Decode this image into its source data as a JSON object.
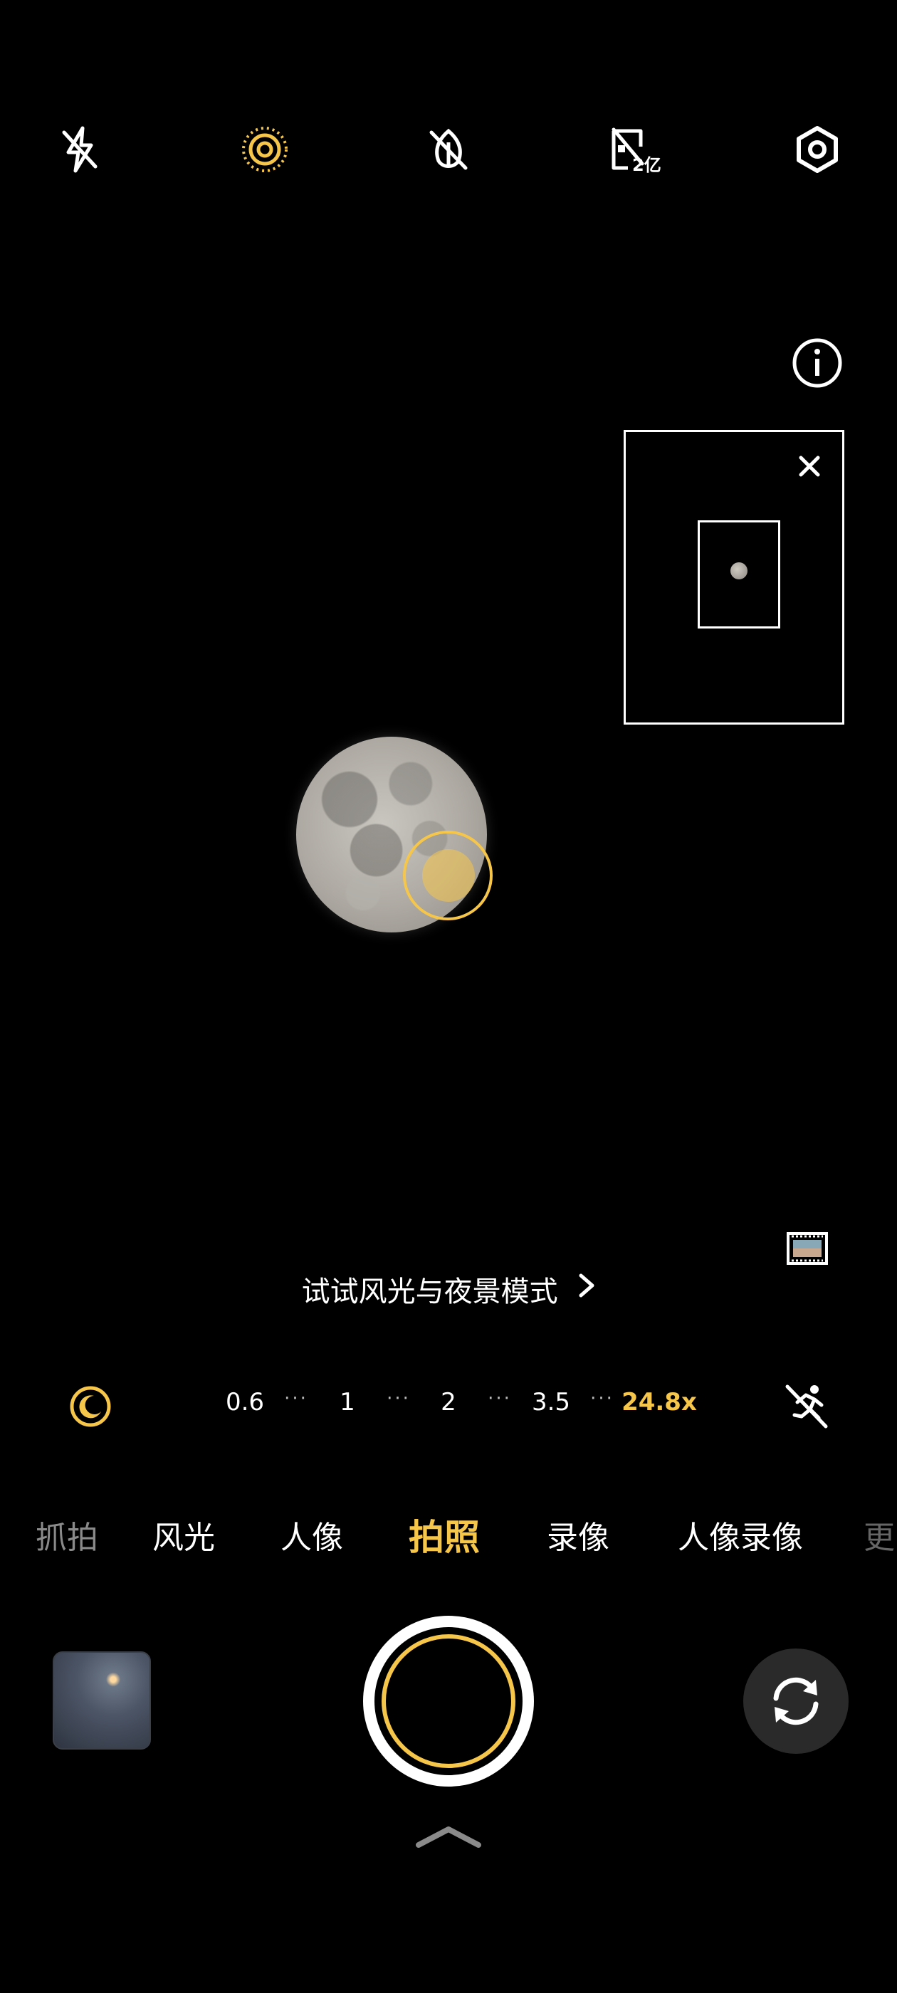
{
  "top_bar": {
    "icons": [
      "flash-off-icon",
      "live-photo-icon",
      "ai-scene-off-icon",
      "resolution-200mp-icon",
      "settings-icon"
    ],
    "resolution_badge": "2亿"
  },
  "viewfinder": {
    "subject": "moon",
    "focus_color": "#f5c64a"
  },
  "hint": {
    "text": "试试风光与夜景模式"
  },
  "zoom": {
    "levels": [
      "0.6",
      "1",
      "2",
      "3.5",
      "24.8x"
    ],
    "active": "24.8x",
    "dots": "···"
  },
  "modes": {
    "items": [
      "抓拍",
      "风光",
      "人像",
      "拍照",
      "录像",
      "人像录像",
      "更"
    ],
    "active": "拍照"
  },
  "colors": {
    "accent": "#f5c64a",
    "background": "#000000"
  }
}
